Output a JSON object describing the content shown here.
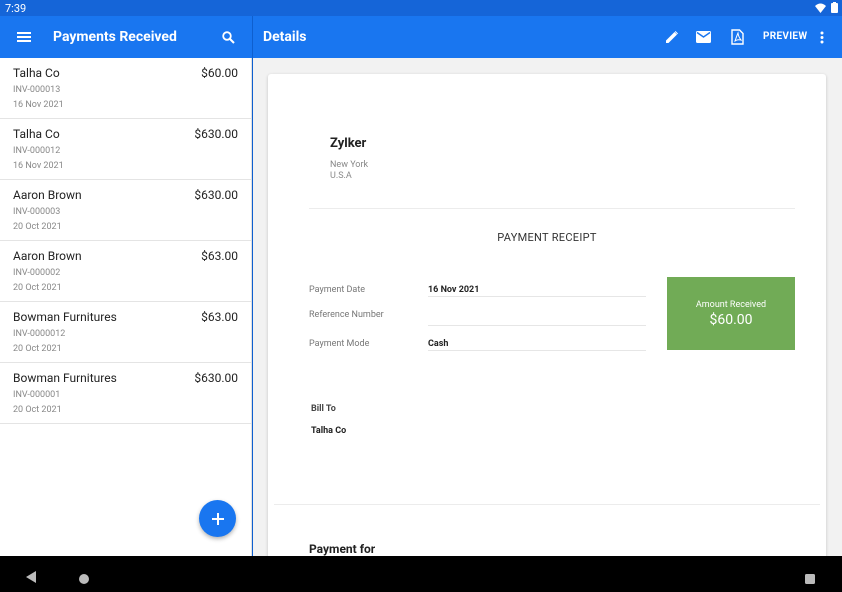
{
  "status_bar": {
    "time": "7:39"
  },
  "left_appbar": {
    "title": "Payments Received"
  },
  "right_appbar": {
    "title": "Details",
    "preview_label": "PREVIEW"
  },
  "payments": [
    {
      "name": "Talha Co",
      "amount": "$60.00",
      "invoice": "INV-000013",
      "date": "16 Nov 2021"
    },
    {
      "name": "Talha Co",
      "amount": "$630.00",
      "invoice": "INV-000012",
      "date": "16 Nov 2021"
    },
    {
      "name": "Aaron Brown",
      "amount": "$630.00",
      "invoice": "INV-000003",
      "date": "20 Oct 2021"
    },
    {
      "name": "Aaron Brown",
      "amount": "$63.00",
      "invoice": "INV-000002",
      "date": "20 Oct 2021"
    },
    {
      "name": "Bowman Furnitures",
      "amount": "$63.00",
      "invoice": "INV-0000012",
      "date": "20 Oct 2021"
    },
    {
      "name": "Bowman Furnitures",
      "amount": "$630.00",
      "invoice": "INV-000001",
      "date": "20 Oct 2021"
    }
  ],
  "receipt": {
    "org_name": "Zylker",
    "org_city": "New York",
    "org_country": "U.S.A",
    "title": "PAYMENT RECEIPT",
    "fields": [
      {
        "label": "Payment Date",
        "value": "16 Nov 2021"
      },
      {
        "label": "Reference Number",
        "value": ""
      },
      {
        "label": "Payment Mode",
        "value": "Cash"
      }
    ],
    "amount_label": "Amount Received",
    "amount_value": "$60.00",
    "bill_to_label": "Bill To",
    "bill_to_value": "Talha Co",
    "payment_for_label": "Payment for"
  },
  "colors": {
    "appbar": "#1976f0",
    "statusbar": "#1565d8",
    "amount_box": "#71ab56"
  },
  "icons": [
    "menu-icon",
    "search-icon",
    "edit-icon",
    "mail-icon",
    "pdf-icon",
    "more-vert-icon",
    "add-icon",
    "back-icon",
    "home-icon",
    "recents-icon",
    "wifi-icon",
    "battery-icon"
  ]
}
